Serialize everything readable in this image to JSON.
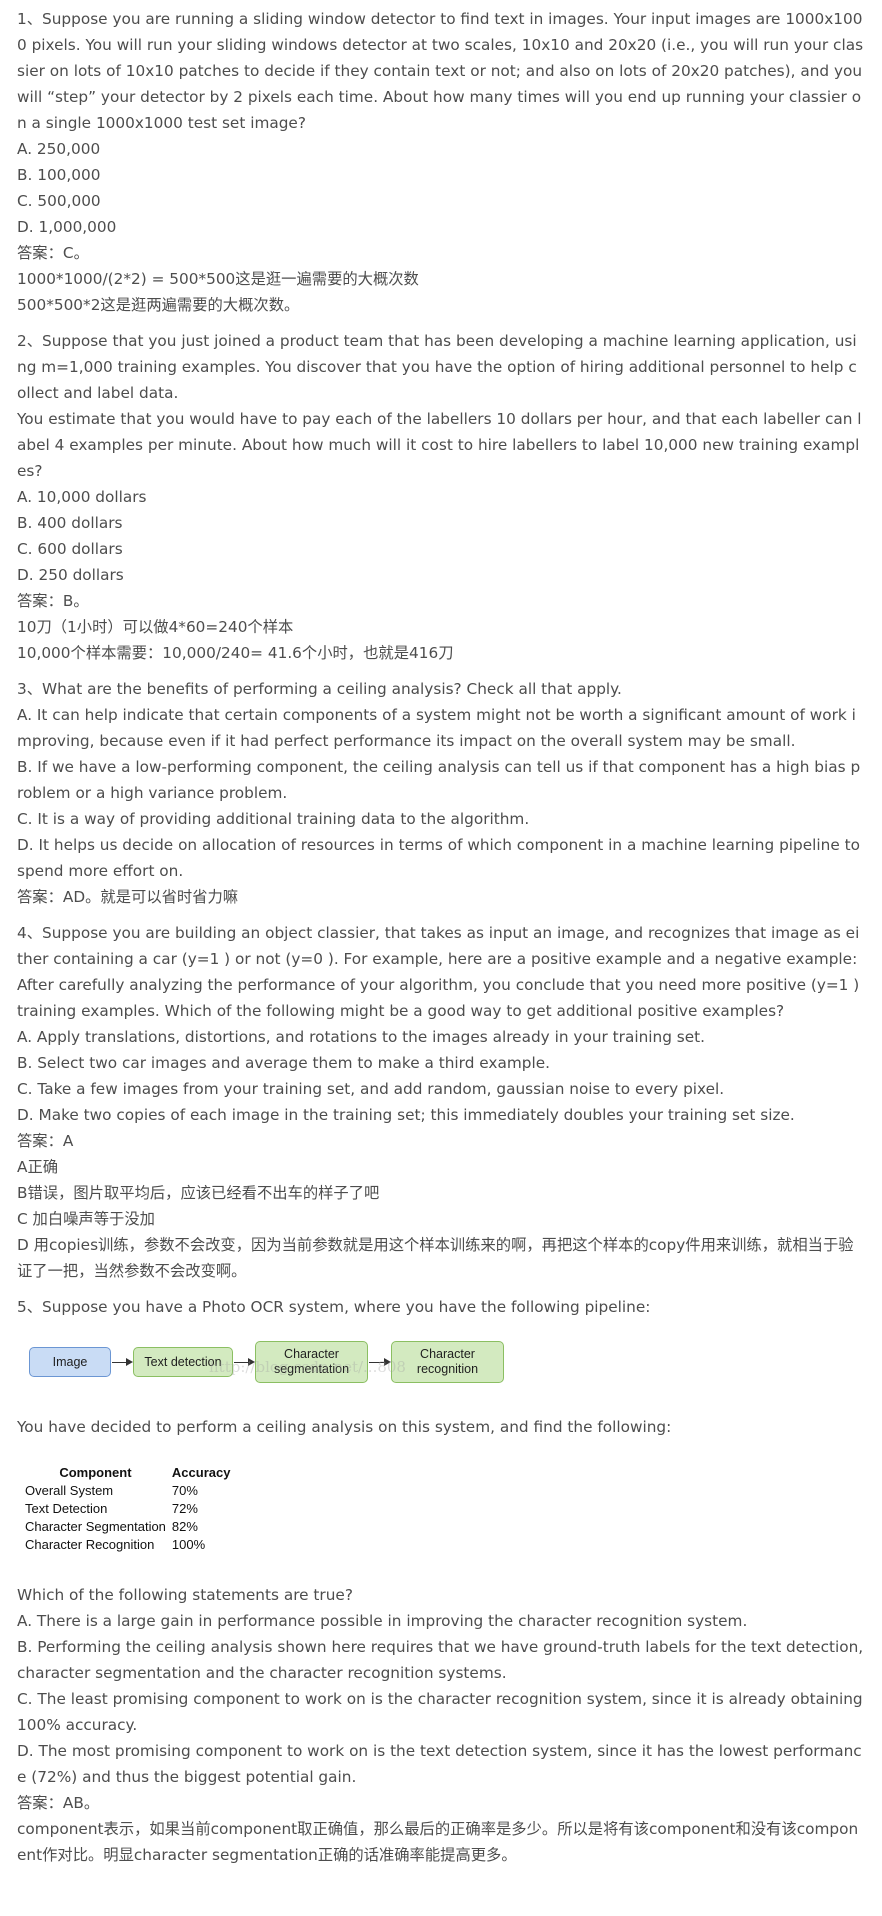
{
  "q1": {
    "lines": [
      "1、Suppose you are running a sliding window detector to find text in images. Your input images are 1000x1000 pixels. You will run your sliding windows detector at two scales, 10x10 and 20x20 (i.e., you will run your classier on lots of 10x10 patches to decide if they contain text or not; and also on lots of 20x20 patches), and you will “step” your detector by 2 pixels each time. About how many times will you end up running your classier on a single 1000x1000 test set image?",
      "A. 250,000",
      "B. 100,000",
      "C. 500,000",
      "D. 1,000,000",
      "答案：C。",
      "1000*1000/(2*2) = 500*500这是逛一遍需要的大概次数",
      "500*500*2这是逛两遍需要的大概次数。"
    ]
  },
  "q2": {
    "lines": [
      "2、Suppose that you just joined a product team that has been developing a machine learning application, using m=1,000 training examples. You discover that you have the option of hiring additional personnel to help collect and label data.",
      "You estimate that you would have to pay each of the labellers 10 dollars per hour, and that each labeller can label 4 examples per minute. About how much will it cost to hire labellers to label 10,000 new training examples?",
      "A. 10,000 dollars",
      "B. 400 dollars",
      "C. 600 dollars",
      "D. 250 dollars",
      "答案：B。",
      "10刀（1小时）可以做4*60=240个样本",
      "10,000个样本需要：10,000/240= 41.6个小时，也就是416刀"
    ]
  },
  "q3": {
    "lines": [
      "3、What are the benefits of performing a ceiling analysis? Check all that apply.",
      "A. It can help indicate that certain components of a system might not be worth a significant amount of work improving, because even if it had perfect performance its impact on the overall system may be small.",
      "B. If we have a low-performing component, the ceiling analysis can tell us if that component has a high bias problem or a high variance problem.",
      "C. It is a way of providing additional training data to the algorithm.",
      "D. It helps us decide on allocation of resources in terms of which component in a machine learning pipeline to spend more effort on.",
      "答案：AD。就是可以省时省力嘛"
    ]
  },
  "q4": {
    "lines": [
      "4、Suppose you are building an object classier, that takes as input an image, and recognizes that image as either containing a car (y=1 ) or not (y=0 ). For example, here are a positive example and a negative example:",
      "After carefully analyzing the performance of your algorithm, you conclude that you need more positive (y=1 ) training examples. Which of the following might be a good way to get additional positive examples?",
      "A. Apply translations, distortions, and rotations to the images already in your training set.",
      "B. Select two car images and average them to make a third example.",
      "C. Take a few images from your training set, and add random, gaussian noise to every pixel.",
      "D. Make two copies of each image in the training set; this immediately doubles your training set size.",
      "答案：A",
      "A正确",
      "B错误，图片取平均后，应该已经看不出车的样子了吧",
      "C 加白噪声等于没加",
      "D 用copies训练，参数不会改变，因为当前参数就是用这个样本训练来的啊，再把这个样本的copy件用来训练，就相当于验证了一把，当然参数不会改变啊。"
    ]
  },
  "q5": {
    "intro": "5、Suppose you have a Photo OCR system, where you have the following pipeline:",
    "pipeline": [
      "Image",
      "Text detection",
      "Character\nsegmentation",
      "Character\nrecognition"
    ],
    "watermark": "http://blog.csdn.net/...808",
    "ceiling_sentence": "You have decided to perform a ceiling analysis on this system, and find the following:",
    "table": {
      "headers": [
        "Component",
        "Accuracy"
      ],
      "rows": [
        [
          "Overall System",
          "70%"
        ],
        [
          "Text Detection",
          "72%"
        ],
        [
          "Character Segmentation",
          "82%"
        ],
        [
          "Character Recognition",
          "100%"
        ]
      ]
    },
    "lines": [
      "Which of the following statements are true?",
      "A. There is a large gain in performance possible in improving the character recognition system.",
      "B. Performing the ceiling analysis shown here requires that we have ground-truth labels for the text detection, character segmentation and the character recognition systems.",
      "C. The least promising component to work on is the character recognition system, since it is already obtaining 100% accuracy.",
      "D. The most promising component to work on is the text detection system, since it has the lowest performance (72%) and thus the biggest potential gain.",
      "答案：AB。",
      "component表示，如果当前component取正确值，那么最后的正确率是多少。所以是将有该component和没有该component作对比。明显character segmentation正确的话准确率能提高更多。"
    ]
  }
}
